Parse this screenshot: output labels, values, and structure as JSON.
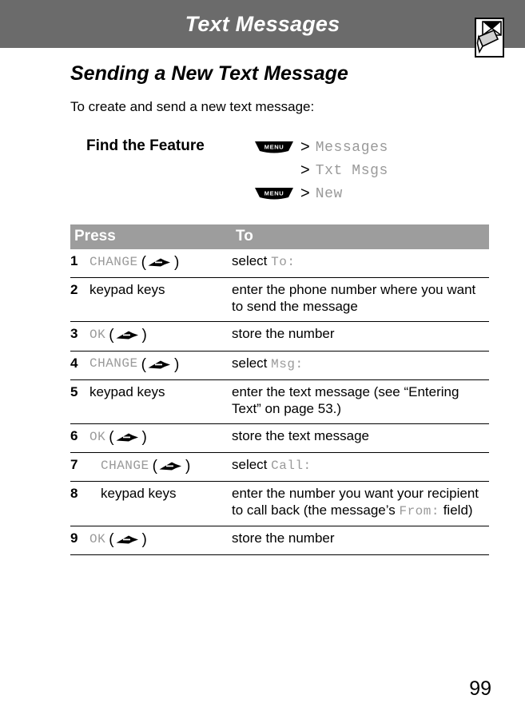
{
  "header": {
    "title": "Text Messages",
    "band_color": "#6b6b6b",
    "icon_name": "envelope-with-note-icon"
  },
  "section": {
    "heading": "Sending a New Text Message",
    "intro": "To create and send a new text message:"
  },
  "find_the_feature": {
    "label": "Find the Feature",
    "lines": [
      {
        "key": "MENU",
        "separator": ">",
        "item": "Messages"
      },
      {
        "key": "",
        "separator": ">",
        "item": "Txt Msgs"
      },
      {
        "key": "MENU",
        "separator": ">",
        "item": "New"
      }
    ]
  },
  "table": {
    "headers": {
      "press": "Press",
      "to": "To"
    },
    "header_bg": "#9d9d9d",
    "rows": [
      {
        "num": "1",
        "press_label": "CHANGE",
        "press_style": "softkey",
        "press_has_key": true,
        "press_indent": false,
        "to_prefix": "select ",
        "to_mono": "To:",
        "to_suffix": ""
      },
      {
        "num": "2",
        "press_label": "keypad keys",
        "press_style": "plain",
        "press_has_key": false,
        "press_indent": false,
        "to_prefix": "enter the phone number where you want to send the message",
        "to_mono": "",
        "to_suffix": ""
      },
      {
        "num": "3",
        "press_label": "OK",
        "press_style": "softkey",
        "press_has_key": true,
        "press_indent": false,
        "to_prefix": "store the number",
        "to_mono": "",
        "to_suffix": ""
      },
      {
        "num": "4",
        "press_label": "CHANGE",
        "press_style": "softkey",
        "press_has_key": true,
        "press_indent": false,
        "to_prefix": "select ",
        "to_mono": "Msg:",
        "to_suffix": ""
      },
      {
        "num": "5",
        "press_label": "keypad keys",
        "press_style": "plain",
        "press_has_key": false,
        "press_indent": false,
        "to_prefix": "enter the text message (see “Entering Text” on page 53.)",
        "to_mono": "",
        "to_suffix": ""
      },
      {
        "num": "6",
        "press_label": "OK",
        "press_style": "softkey",
        "press_has_key": true,
        "press_indent": false,
        "to_prefix": "store the text message",
        "to_mono": "",
        "to_suffix": ""
      },
      {
        "num": "7",
        "press_label": "CHANGE",
        "press_style": "softkey",
        "press_has_key": true,
        "press_indent": true,
        "to_prefix": "select ",
        "to_mono": "Call:",
        "to_suffix": ""
      },
      {
        "num": "8",
        "press_label": "keypad keys",
        "press_style": "plain",
        "press_has_key": false,
        "press_indent": true,
        "to_prefix": "enter the number you want your recipient to call back (the message’s ",
        "to_mono": "From:",
        "to_suffix": " field)"
      },
      {
        "num": "9",
        "press_label": "OK",
        "press_style": "softkey",
        "press_has_key": true,
        "press_indent": false,
        "to_prefix": "store the number",
        "to_mono": "",
        "to_suffix": ""
      }
    ]
  },
  "footer": {
    "page_number": "99"
  }
}
